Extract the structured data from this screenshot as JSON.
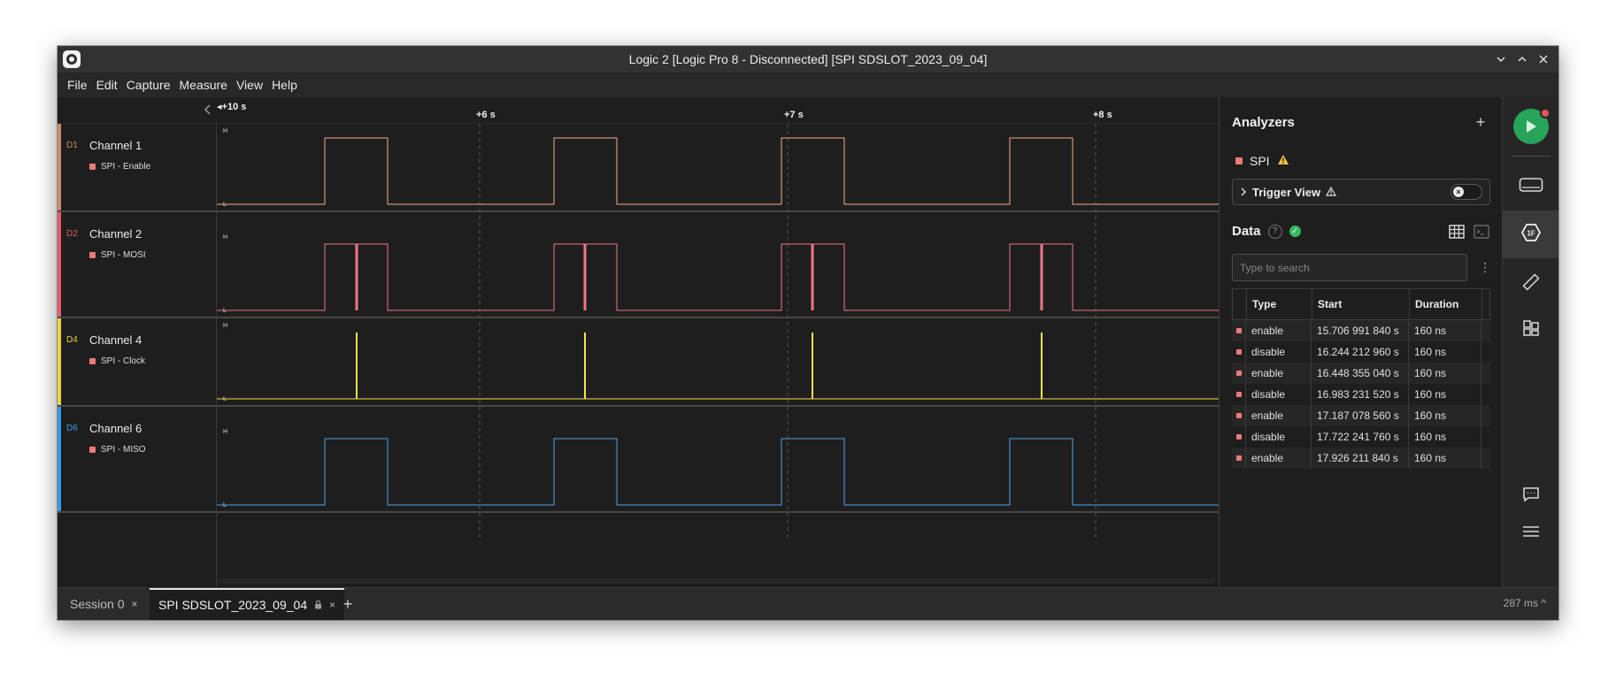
{
  "window": {
    "title": "Logic 2 [Logic Pro 8 - Disconnected] [SPI SDSLOT_2023_09_04]"
  },
  "menu": [
    "File",
    "Edit",
    "Capture",
    "Measure",
    "View",
    "Help"
  ],
  "ruler": {
    "start": "+10 s",
    "ticks": [
      "+6 s",
      "+7 s",
      "+8 s"
    ]
  },
  "channels": [
    {
      "id": "D1",
      "name": "Channel 1",
      "analyzer": "SPI - Enable",
      "color": "#f7a98f"
    },
    {
      "id": "D2",
      "name": "Channel 2",
      "analyzer": "SPI - MOSI",
      "color": "#f27585"
    },
    {
      "id": "D4",
      "name": "Channel 4",
      "analyzer": "SPI - Clock",
      "color": "#f5e050"
    },
    {
      "id": "D6",
      "name": "Channel 6",
      "analyzer": "SPI - MISO",
      "color": "#4aa3f0"
    }
  ],
  "level_labels": {
    "high": "H",
    "low": "L"
  },
  "analyzers": {
    "title": "Analyzers",
    "items": [
      {
        "name": "SPI",
        "warning": true
      }
    ],
    "trigger_view": "Trigger View"
  },
  "data": {
    "title": "Data",
    "search_placeholder": "Type to search",
    "columns": [
      "Type",
      "Start",
      "Duration"
    ],
    "rows": [
      {
        "type": "enable",
        "start": "15.706 991 840 s",
        "duration": "160 ns"
      },
      {
        "type": "disable",
        "start": "16.244 212 960 s",
        "duration": "160 ns"
      },
      {
        "type": "enable",
        "start": "16.448 355 040 s",
        "duration": "160 ns"
      },
      {
        "type": "disable",
        "start": "16.983 231 520 s",
        "duration": "160 ns"
      },
      {
        "type": "enable",
        "start": "17.187 078 560 s",
        "duration": "160 ns"
      },
      {
        "type": "disable",
        "start": "17.722 241 760 s",
        "duration": "160 ns"
      },
      {
        "type": "enable",
        "start": "17.926 211 840 s",
        "duration": "160 ns"
      }
    ]
  },
  "tabs": [
    {
      "label": "Session 0",
      "active": false
    },
    {
      "label": "SPI SDSLOT_2023_09_04",
      "active": true,
      "locked": true
    }
  ],
  "status": {
    "latency": "287 ms"
  },
  "colors": {
    "accent_green": "#27a35a",
    "analyzer_marker": "#f07a7a",
    "record_dot": "#e0565c"
  }
}
